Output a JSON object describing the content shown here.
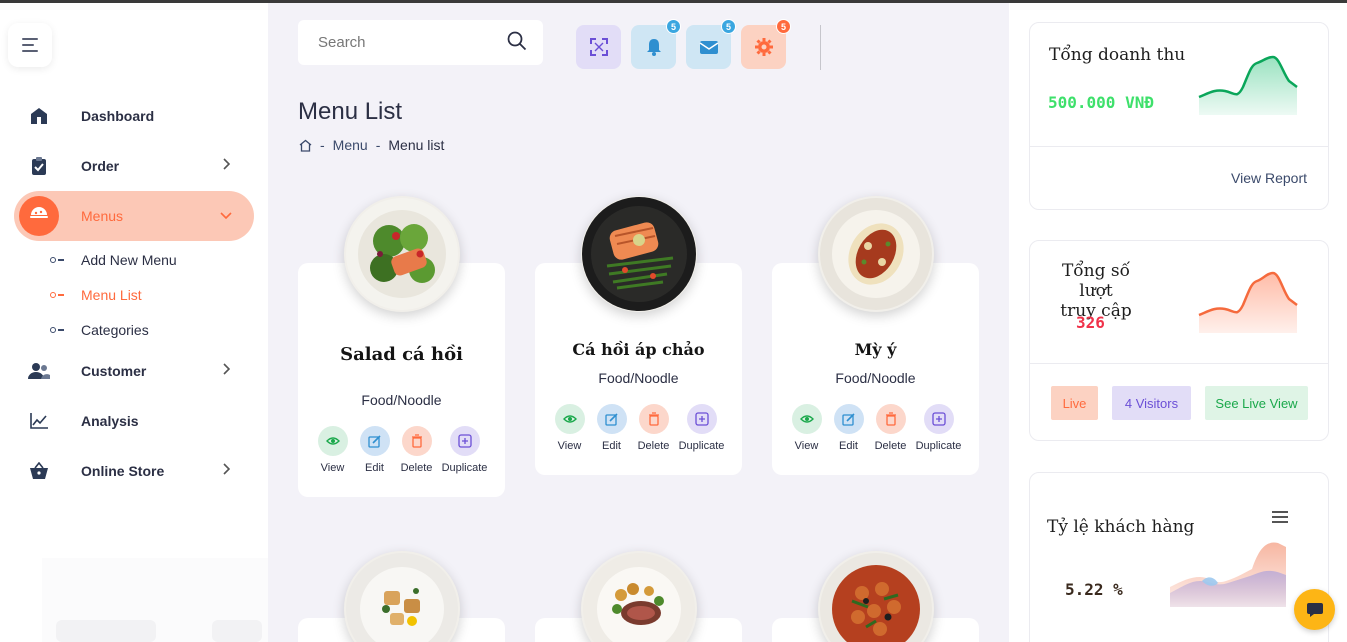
{
  "sidebar": {
    "items": [
      {
        "label": "Dashboard",
        "icon": "home-icon"
      },
      {
        "label": "Order",
        "icon": "clipboard-icon"
      },
      {
        "label": "Menus",
        "icon": "food-icon"
      },
      {
        "label": "Customer",
        "icon": "users-icon"
      },
      {
        "label": "Analysis",
        "icon": "chart-line-icon"
      },
      {
        "label": "Online Store",
        "icon": "basket-icon"
      }
    ],
    "submenu": [
      {
        "label": "Add New Menu"
      },
      {
        "label": "Menu List"
      },
      {
        "label": "Categories"
      }
    ]
  },
  "topbar": {
    "search_placeholder": "Search",
    "notifications_count": "5",
    "messages_count": "5",
    "settings_count": "5"
  },
  "page": {
    "title": "Menu List",
    "breadcrumb": [
      "Menu",
      "Menu list"
    ]
  },
  "cards": [
    {
      "title": "Salad cá hồi",
      "category": "Food/Noodle"
    },
    {
      "title": "Cá hồi áp chảo",
      "category": "Food/Noodle"
    },
    {
      "title": "Mỳ ý",
      "category": "Food/Noodle"
    }
  ],
  "card_actions": {
    "view": "View",
    "edit": "Edit",
    "delete": "Delete",
    "duplicate": "Duplicate"
  },
  "right": {
    "revenue": {
      "title": "Tổng doanh thu",
      "value": "500.000 VNĐ",
      "link": "View Report"
    },
    "visits": {
      "title_line1": "Tổng số lượt",
      "title_line2": "truy cập",
      "value": "326",
      "live": "Live",
      "visitors": "4 Visitors",
      "live_view": "See Live View"
    },
    "customers": {
      "title": "Tỷ lệ khách hàng",
      "value": "5.22 %"
    }
  },
  "colors": {
    "accent": "#ff6a3d",
    "active_bg": "#fcc8b6",
    "revenue_green": "#3ee06b",
    "visits_red": "#f0324a",
    "badge_blue": "#3aa6e0",
    "badge_orange": "#ff6a3d"
  }
}
